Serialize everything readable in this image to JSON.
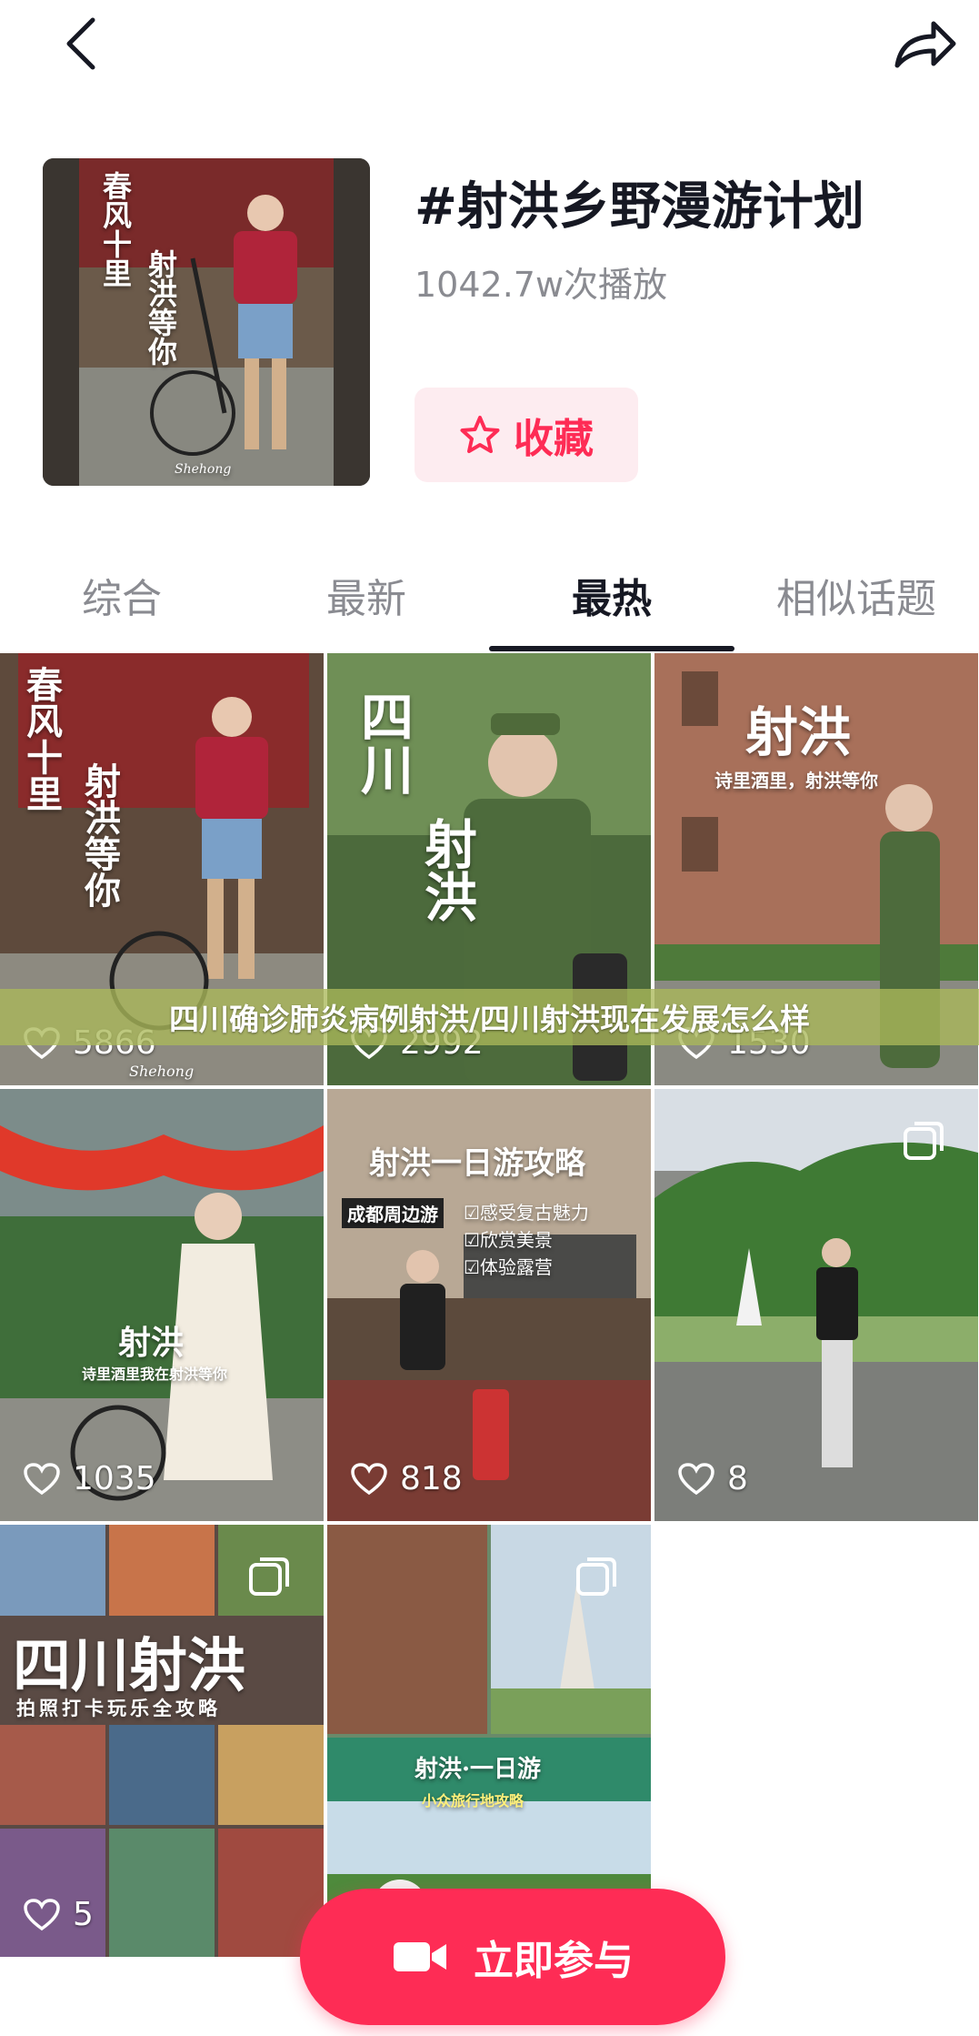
{
  "topic": {
    "title": "#射洪乡野漫游计划",
    "plays": "1042.7w次播放",
    "favorite_label": "收藏"
  },
  "tabs": [
    {
      "label": "综合"
    },
    {
      "label": "最新"
    },
    {
      "label": "最热"
    },
    {
      "label": "相似话题"
    }
  ],
  "active_tab": "最热",
  "banner": "四川确诊肺炎病例射洪/四川射洪现在发展怎么样",
  "videos": [
    {
      "likes": "5866",
      "overlay": [
        "春风十里",
        "射洪等你"
      ],
      "caption": "Shehong"
    },
    {
      "likes": "2992",
      "overlay": [
        "四川",
        "射洪"
      ]
    },
    {
      "likes": "1530",
      "overlay": [
        "射洪",
        "诗里酒里，射洪等你"
      ]
    },
    {
      "likes": "1035",
      "overlay": [
        "射洪",
        "诗里酒里我在射洪等你"
      ]
    },
    {
      "likes": "818",
      "overlay": [
        "射洪一日游攻略",
        "成都周边游",
        "☑感受复古魅力",
        "☑欣赏美景",
        "☑体验露营"
      ]
    },
    {
      "likes": "8"
    },
    {
      "likes": "5",
      "overlay": [
        "四川射洪",
        "拍照打卡玩乐全攻略"
      ]
    },
    {
      "overlay": [
        "射洪·一日游",
        "小众旅行地攻略"
      ]
    }
  ],
  "join_button": "立即参与",
  "colors": {
    "accent": "#fe2c55",
    "fav_bg": "#fdecf0",
    "text_primary": "#161823",
    "text_secondary": "#8a8b91"
  }
}
